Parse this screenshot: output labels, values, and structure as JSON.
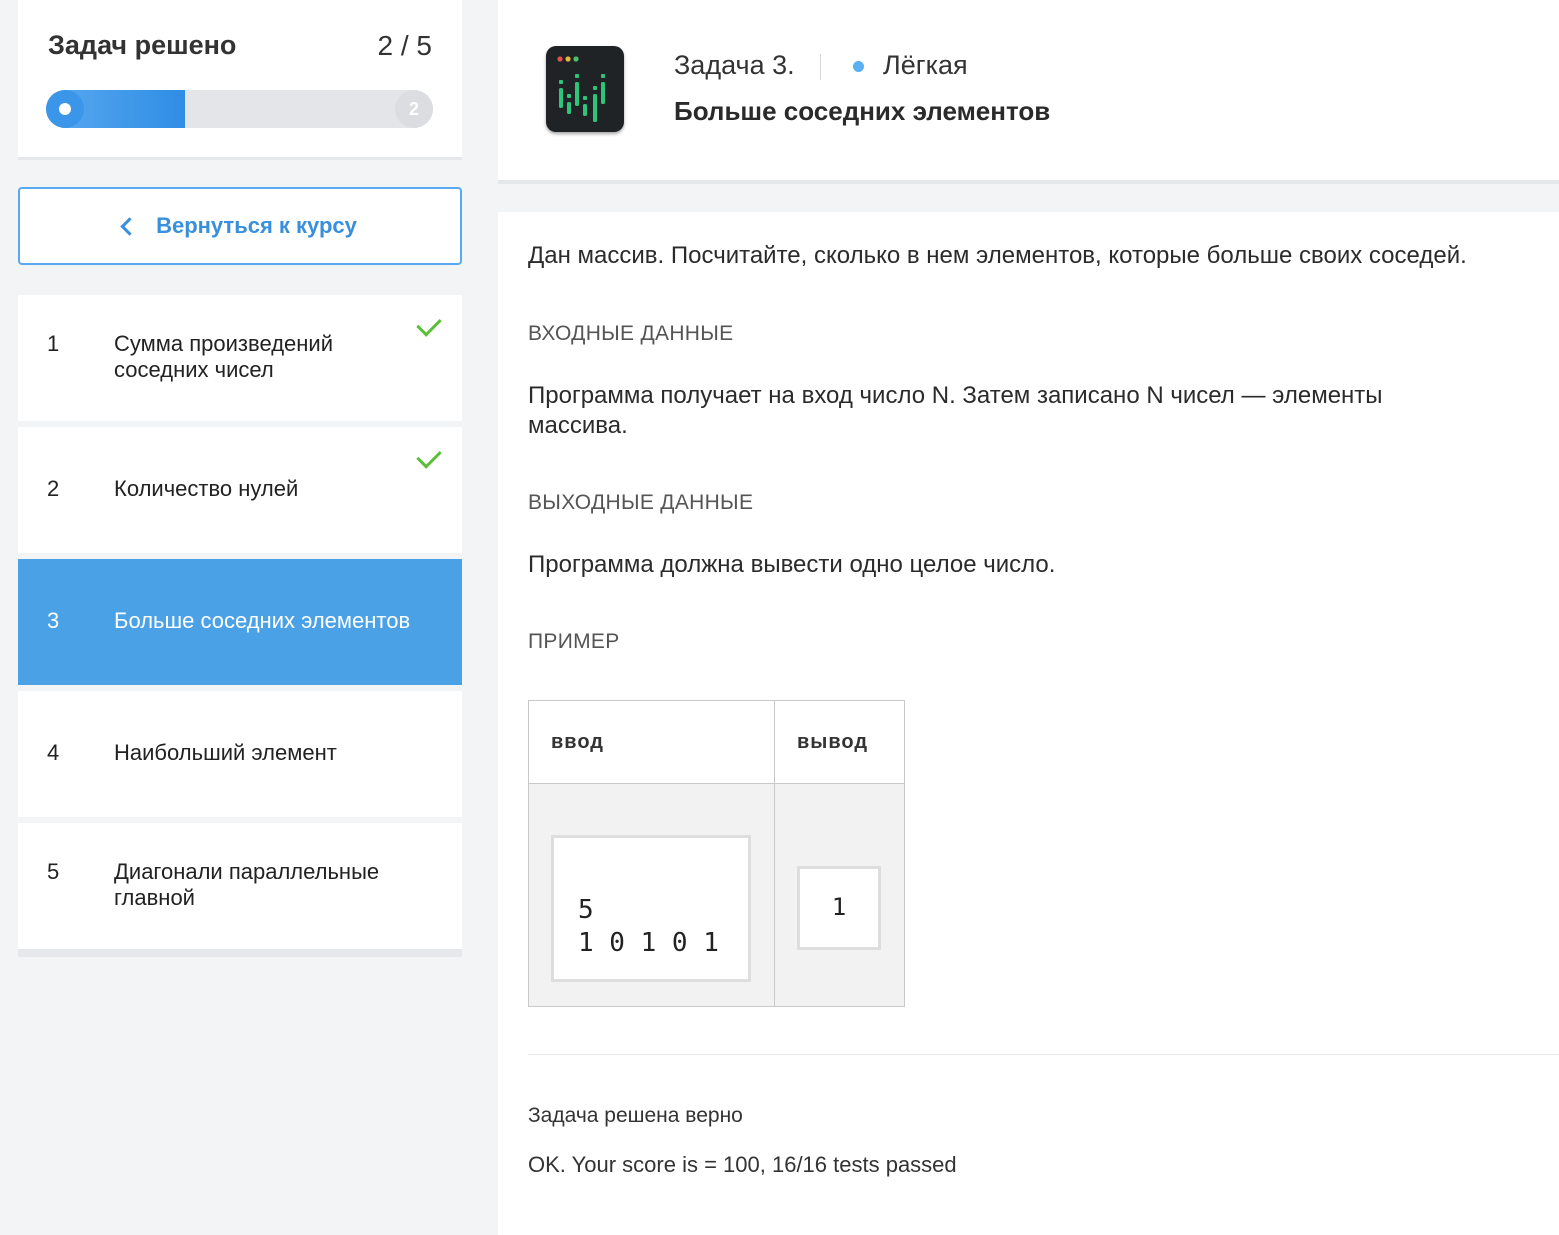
{
  "sidebar": {
    "progress": {
      "title": "Задач решено",
      "count": "2 / 5",
      "solved": 2,
      "total": 5,
      "end_marker": "2"
    },
    "back_button": "Вернуться к курсу",
    "tasks": [
      {
        "num": "1",
        "label": "Сумма произведений соседних чисел",
        "solved": true,
        "active": false
      },
      {
        "num": "2",
        "label": "Количество нулей",
        "solved": true,
        "active": false
      },
      {
        "num": "3",
        "label": "Больше соседних элементов",
        "solved": false,
        "active": true
      },
      {
        "num": "4",
        "label": "Наибольший элемент",
        "solved": false,
        "active": false
      },
      {
        "num": "5",
        "label": "Диагонали параллельные главной",
        "solved": false,
        "active": false
      }
    ]
  },
  "header": {
    "task_number": "Задача 3.",
    "difficulty": "Лёгкая",
    "title": "Больше соседних элементов",
    "accent_color": "#4aa1e6"
  },
  "body": {
    "description": "Дан массив. Посчитайте, сколько в нем элементов, которые больше своих соседей.",
    "input_label": "ВХОДНЫЕ ДАННЫЕ",
    "input_text": "Программа получает на вход число N. Затем записано N чисел — элементы массива.",
    "output_label": "ВЫХОДНЫЕ ДАННЫЕ",
    "output_text": "Программа должна вывести одно целое число.",
    "example_label": "ПРИМЕР",
    "example": {
      "col_input": "ввод",
      "col_output": "вывод",
      "input_value": "5\n1 0 1 0 1",
      "output_value": "1"
    },
    "result_title": "Задача решена верно",
    "result_score": "OK. Your score is = 100, 16/16 tests passed"
  }
}
